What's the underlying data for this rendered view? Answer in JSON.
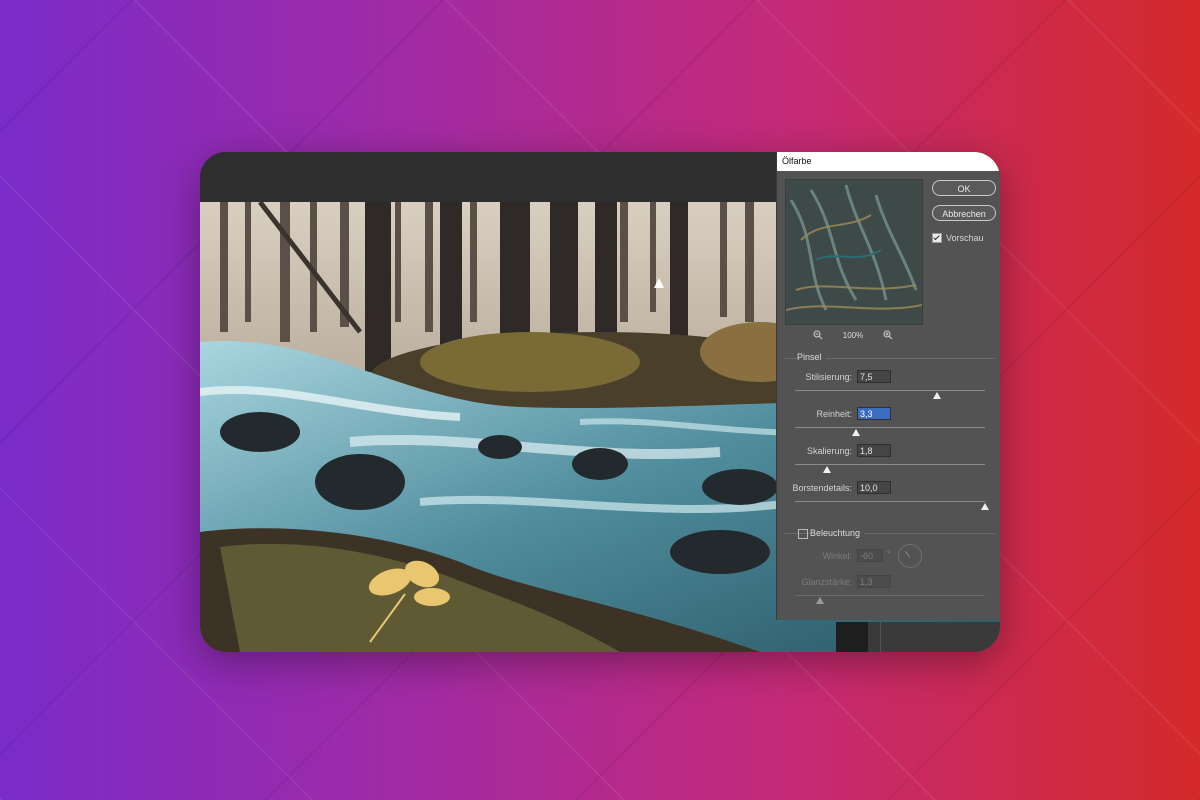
{
  "colors": {
    "background_left": "#7a2bc9",
    "background_right": "#d42a2a",
    "dialog_bg": "#535353",
    "selection": "#3a6cc0"
  },
  "dialog": {
    "title": "Ölfarbe",
    "ok_label": "OK",
    "cancel_label": "Abbrechen",
    "preview_label": "Vorschau",
    "preview_checked": true,
    "zoom_level": "100%",
    "zoom_out_icon": "zoom-out-icon",
    "zoom_in_icon": "zoom-in-icon"
  },
  "brush": {
    "section_label": "Pinsel",
    "stylization": {
      "label": "Stilisierung:",
      "value": "7,5",
      "fraction": 0.75
    },
    "cleanliness": {
      "label": "Reinheit:",
      "value": "3,3",
      "fraction": 0.33
    },
    "scale": {
      "label": "Skalierung:",
      "value": "1,8",
      "fraction": 0.17
    },
    "bristle_detail": {
      "label": "Borstendetails:",
      "value": "10,0",
      "fraction": 1.0
    }
  },
  "lighting": {
    "section_label": "Beleuchtung",
    "checked": false,
    "angle": {
      "label": "Winkel:",
      "value": "-60",
      "unit": "°"
    },
    "shine": {
      "label": "Glanzstärke:",
      "value": "1,3",
      "fraction": 0.13
    }
  }
}
